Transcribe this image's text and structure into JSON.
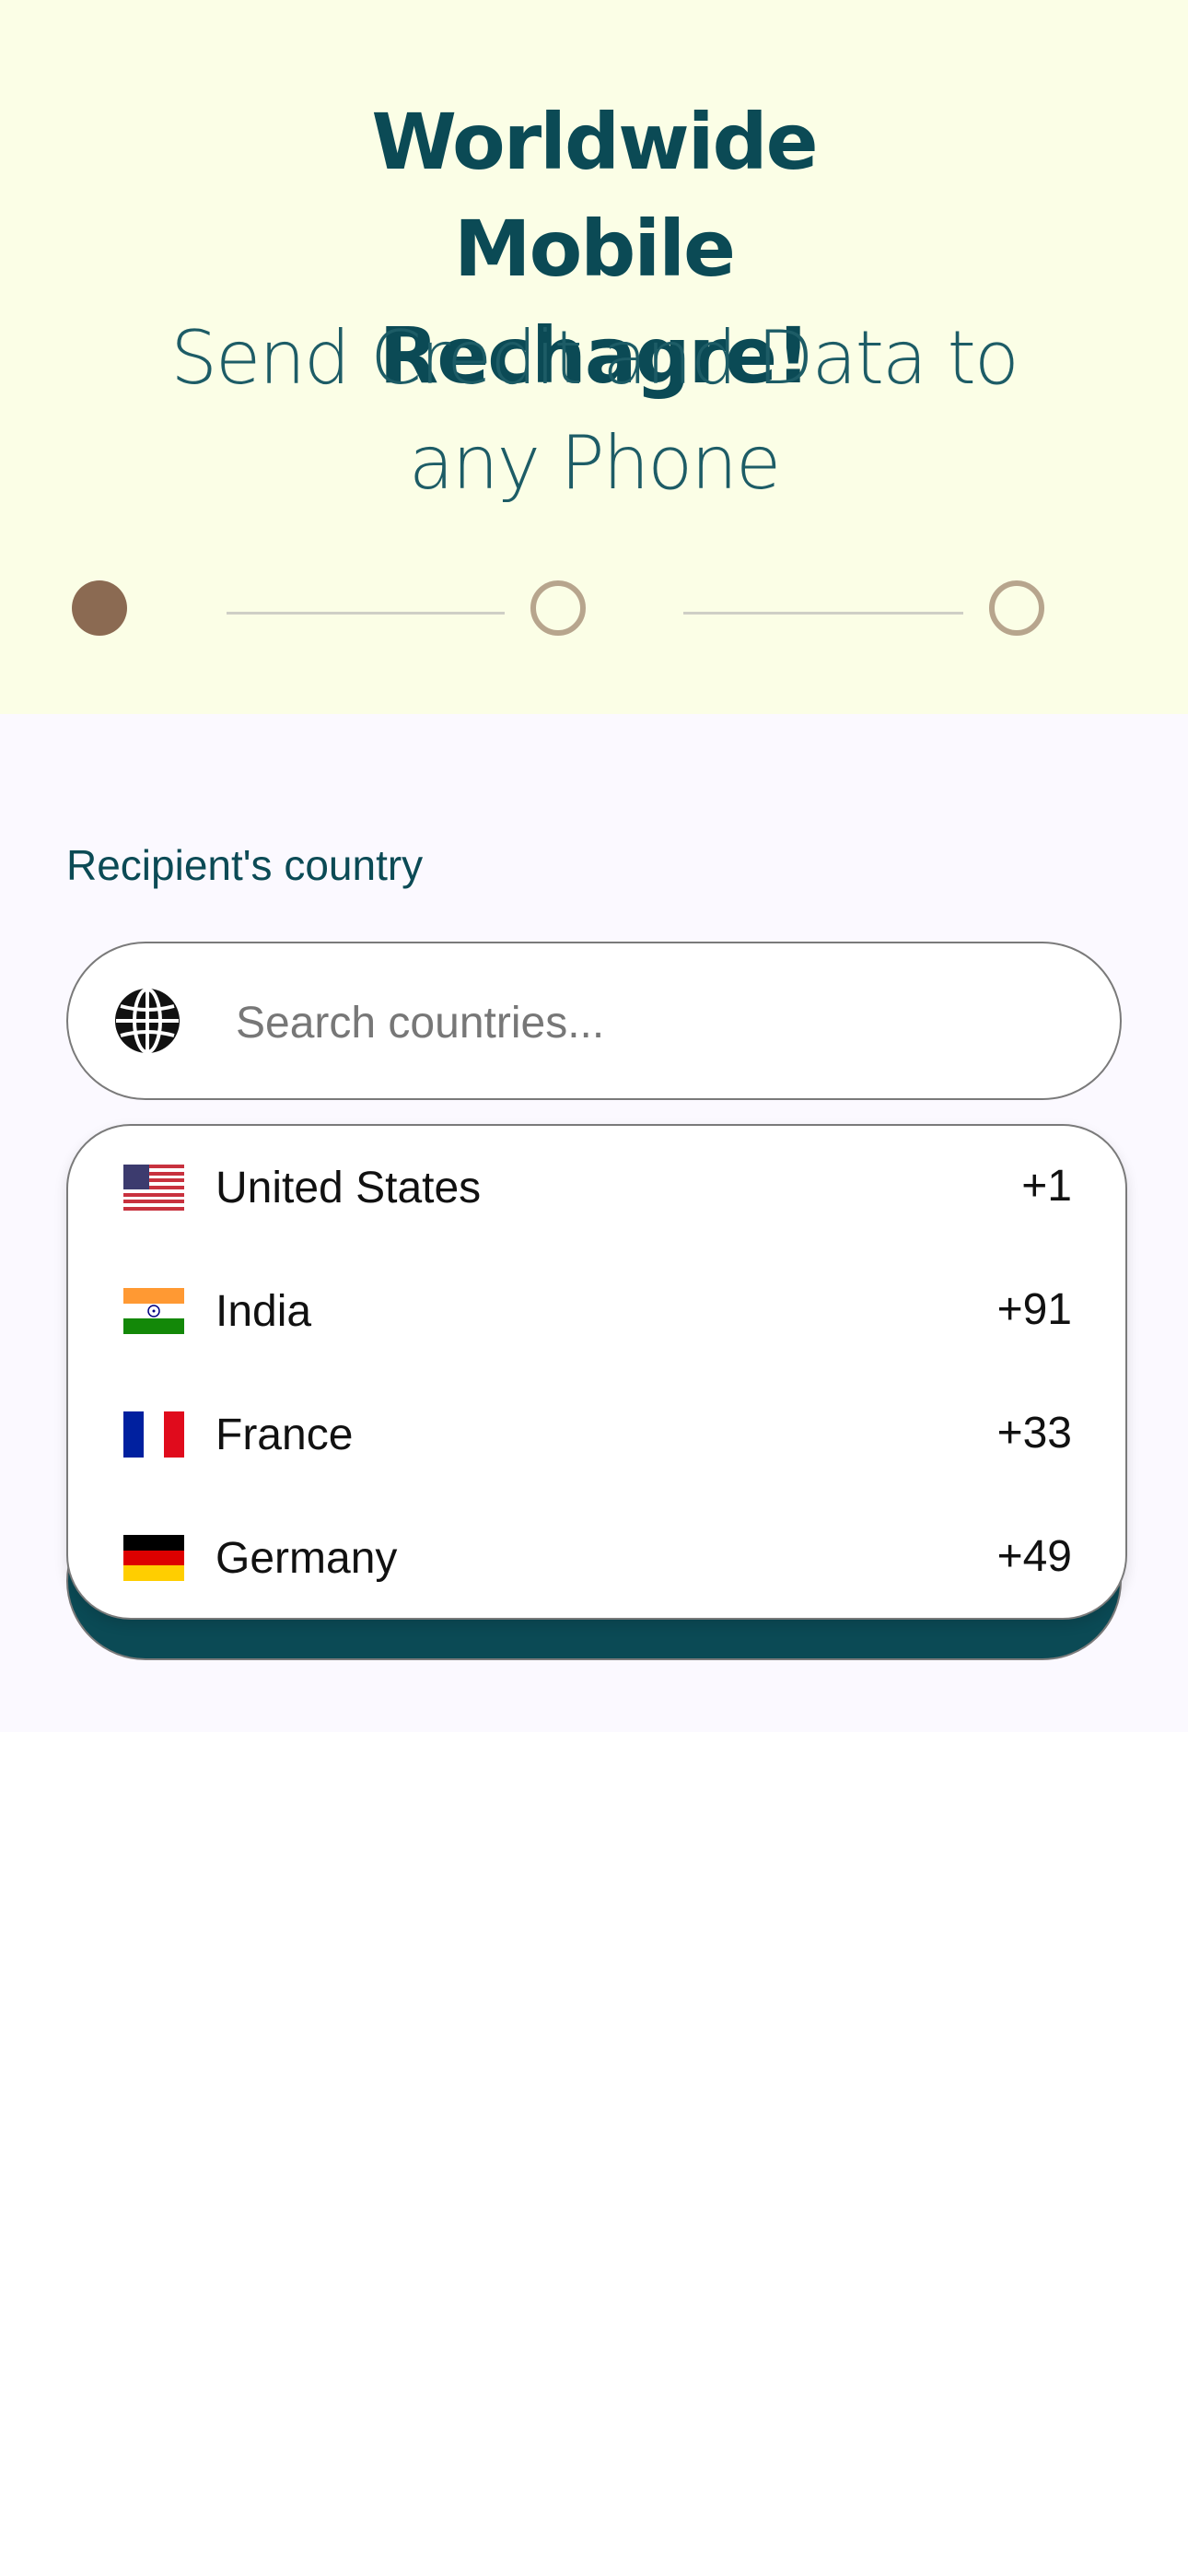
{
  "hero": {
    "title": "Worldwide Mobile Rechagre!",
    "subtitle": "Send Credit and Data to any Phone",
    "steps": [
      {
        "state": "active"
      },
      {
        "state": "inactive"
      },
      {
        "state": "inactive"
      }
    ]
  },
  "form": {
    "recipient_country_label": "Recipient's country",
    "search": {
      "placeholder": "Search countries...",
      "value": "",
      "icon": "globe-icon"
    },
    "submit_label": ""
  },
  "dropdown": {
    "countries": [
      {
        "name": "United States",
        "code": "+1",
        "flag": "us-flag-icon"
      },
      {
        "name": "India",
        "code": "+91",
        "flag": "india-flag-icon"
      },
      {
        "name": "France",
        "code": "+33",
        "flag": "france-flag-icon"
      },
      {
        "name": "Germany",
        "code": "+49",
        "flag": "germany-flag-icon"
      }
    ]
  },
  "colors": {
    "hero_background": "#fbfee6",
    "primary_teal": "#0b4a55",
    "step_active": "#8b6a52",
    "step_inactive": "#b7a58d",
    "panel_background": "#fbf9ff"
  }
}
